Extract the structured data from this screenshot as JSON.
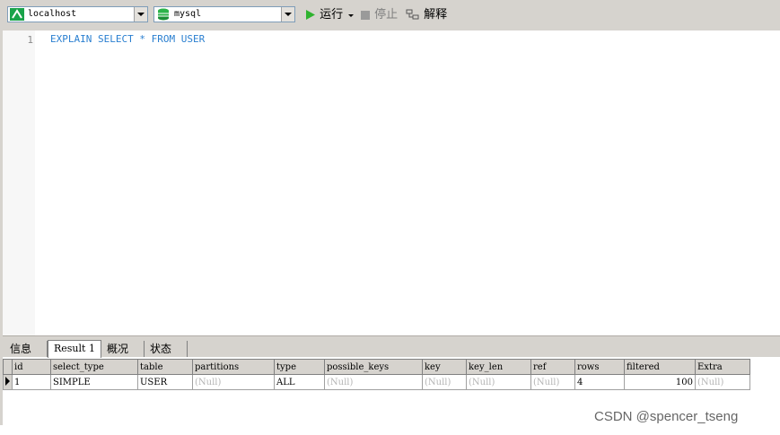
{
  "toolbar": {
    "connection": {
      "value": "localhost",
      "icon": "connection-icon"
    },
    "database": {
      "value": "mysql",
      "icon": "database-icon"
    },
    "run_label": "运行",
    "stop_label": "停止",
    "explain_label": "解释"
  },
  "editor": {
    "line_number": "1",
    "code": "EXPLAIN SELECT * FROM USER",
    "keyword_color": "#2a7fd0"
  },
  "tabs": [
    {
      "label": "信息"
    },
    {
      "label": "Result 1"
    },
    {
      "label": "概况"
    },
    {
      "label": "状态"
    }
  ],
  "result": {
    "columns": [
      "id",
      "select_type",
      "table",
      "partitions",
      "type",
      "possible_keys",
      "key",
      "key_len",
      "ref",
      "rows",
      "filtered",
      "Extra"
    ],
    "row": {
      "id": "1",
      "select_type": "SIMPLE",
      "table": "USER",
      "partitions": "(Null)",
      "type": "ALL",
      "possible_keys": "(Null)",
      "key": "(Null)",
      "key_len": "(Null)",
      "ref": "(Null)",
      "rows": "4",
      "filtered": "100",
      "Extra": "(Null)"
    }
  },
  "watermark": "CSDN @spencer_tseng"
}
